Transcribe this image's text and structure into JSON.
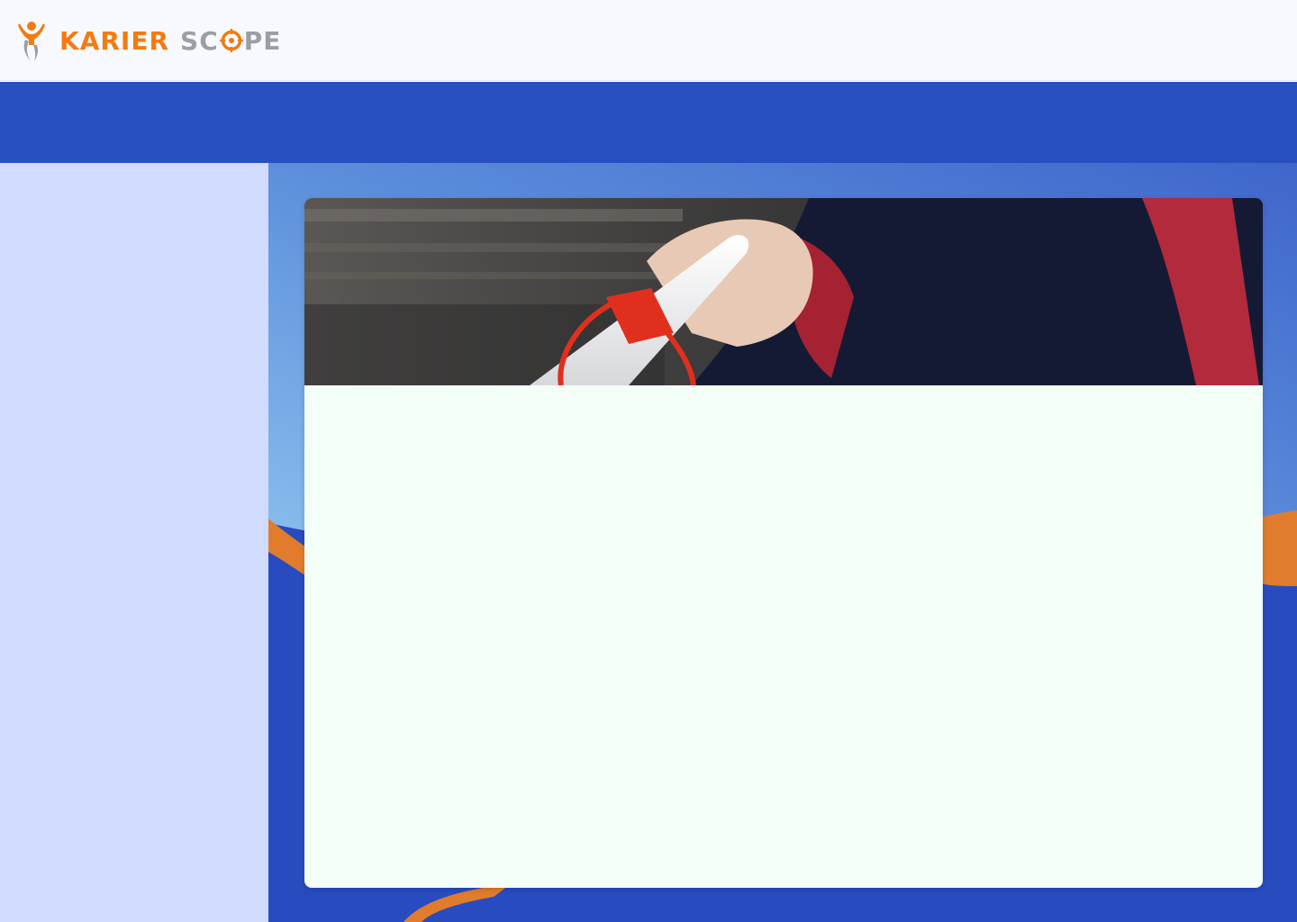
{
  "brand": {
    "name_part1": "KARIER",
    "name_part2_a": "SC",
    "name_part2_b": "PE",
    "logo_icon": "person-target-logo-icon",
    "primary_color": "#f07c12",
    "secondary_color": "#9a9ea5"
  },
  "colors": {
    "topbar_bg": "#f7f9fe",
    "banner_blue": "#284fbf",
    "sidebar_bg": "#d1dbfd",
    "card_bg": "#f3fef6",
    "accent_orange": "#e07c2c"
  },
  "hero": {
    "image": "graduate-holding-diploma-photo"
  }
}
